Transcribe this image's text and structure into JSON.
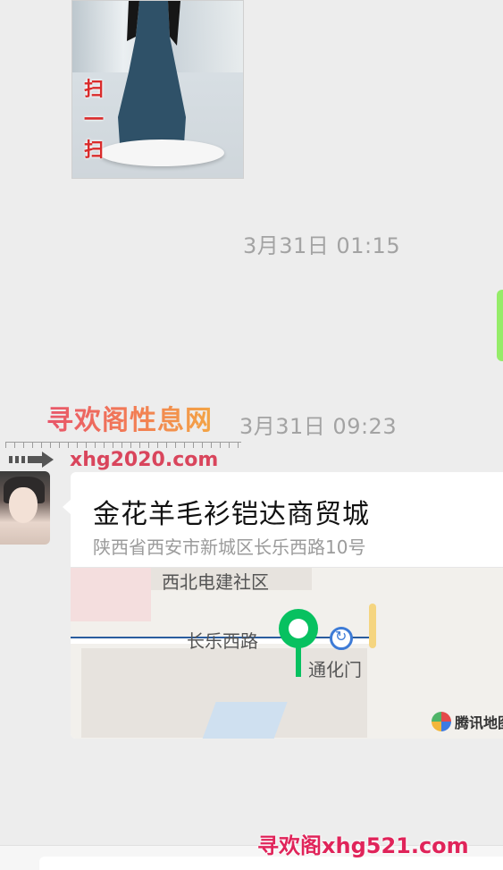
{
  "image_message": {
    "overlay_text": [
      "扫",
      "一",
      "扫"
    ]
  },
  "timestamps": {
    "first": "3月31日 01:15",
    "second": "3月31日 09:23"
  },
  "watermark": {
    "site_name": "寻欢阁性息网",
    "url": "xhg2020.com",
    "bottom_text": "寻欢阁xhg521.com"
  },
  "location_message": {
    "title": "金花羊毛衫铠达商贸城",
    "address": "陕西省西安市新城区长乐西路10号",
    "map_labels": {
      "area": "西北电建社区",
      "road": "长乐西路",
      "station": "通化门",
      "brand": "腾讯地图"
    }
  },
  "colors": {
    "chat_bg": "#ededed",
    "sent_bubble": "#95ec69",
    "pin": "#07c160",
    "timestamp": "#a3a3a3"
  }
}
